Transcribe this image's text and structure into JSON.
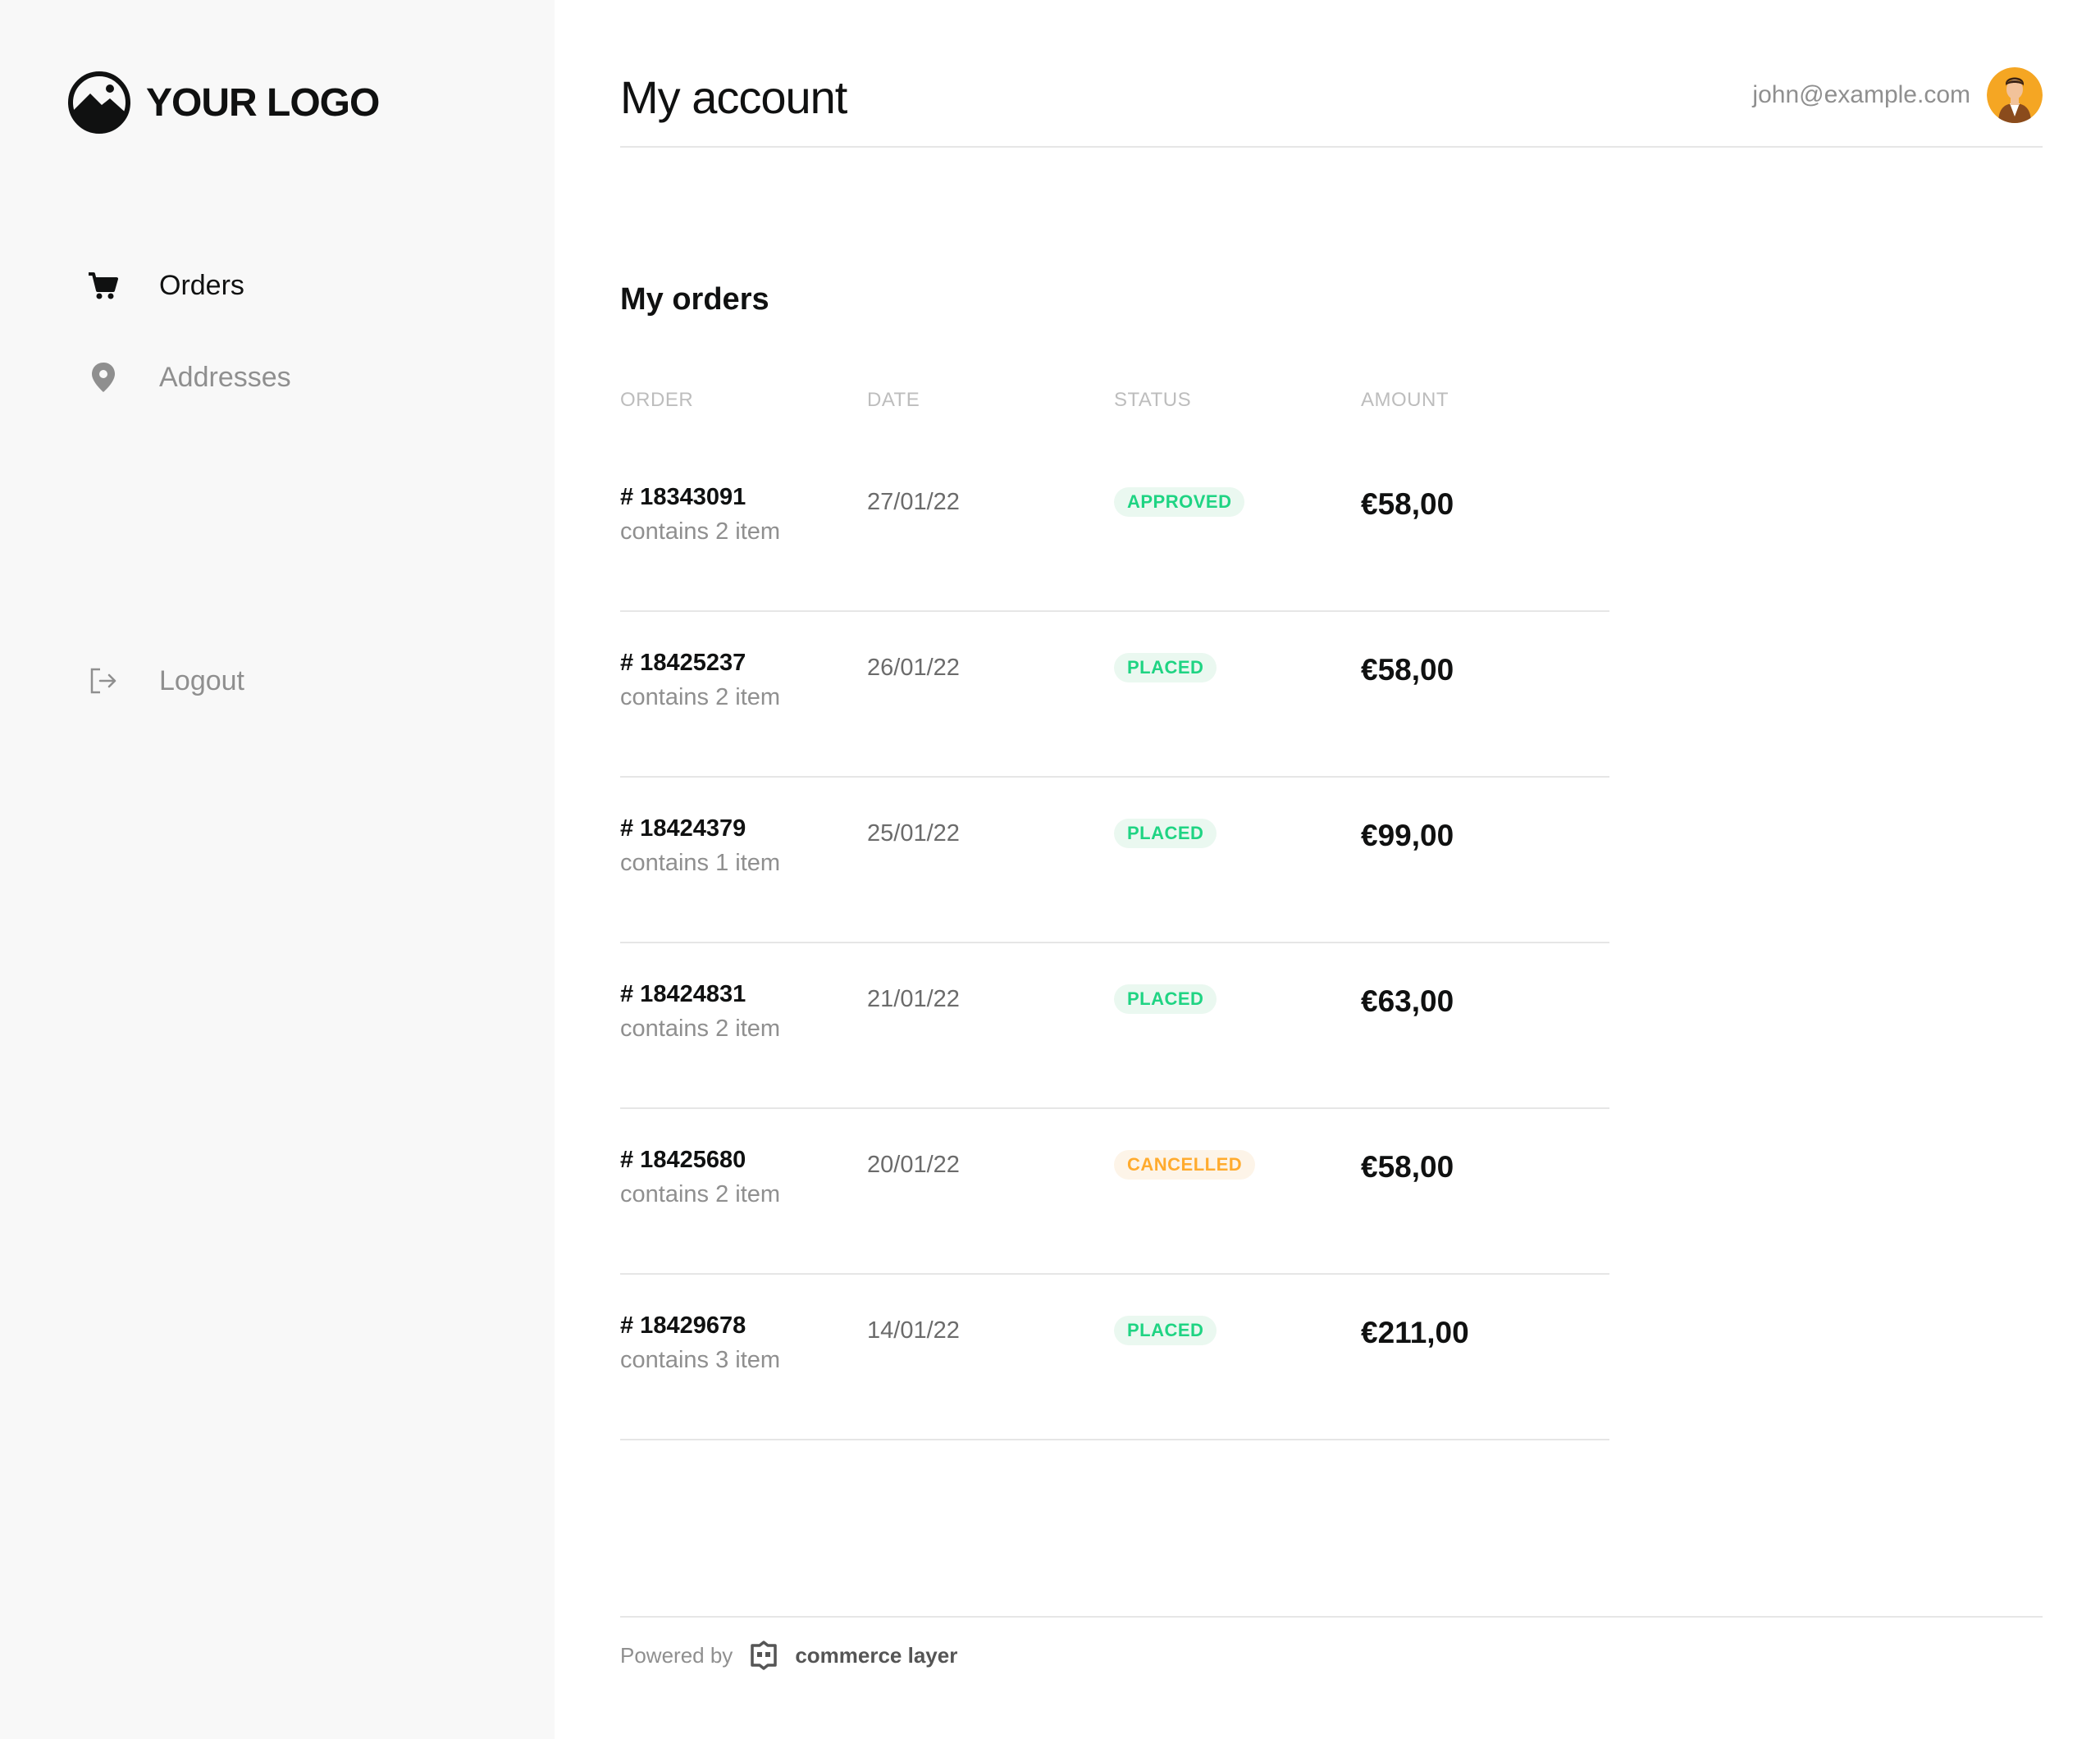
{
  "brand": {
    "logo_text": "YOUR LOGO"
  },
  "sidebar": {
    "items": [
      {
        "label": "Orders",
        "icon": "cart-icon",
        "active": true
      },
      {
        "label": "Addresses",
        "icon": "map-pin-icon",
        "active": false
      }
    ],
    "logout": {
      "label": "Logout",
      "icon": "logout-icon"
    }
  },
  "header": {
    "title": "My account",
    "user_email": "john@example.com"
  },
  "orders": {
    "title": "My orders",
    "columns": [
      "ORDER",
      "DATE",
      "STATUS",
      "AMOUNT"
    ],
    "rows": [
      {
        "number": "# 18343091",
        "items": "contains 2 item",
        "date": "27/01/22",
        "status": "APPROVED",
        "amount": "€58,00"
      },
      {
        "number": "# 18425237",
        "items": "contains 2 item",
        "date": "26/01/22",
        "status": "PLACED",
        "amount": "€58,00"
      },
      {
        "number": "# 18424379",
        "items": "contains 1 item",
        "date": "25/01/22",
        "status": "PLACED",
        "amount": "€99,00"
      },
      {
        "number": "# 18424831",
        "items": "contains 2 item",
        "date": "21/01/22",
        "status": "PLACED",
        "amount": "€63,00"
      },
      {
        "number": "# 18425680",
        "items": "contains 2 item",
        "date": "20/01/22",
        "status": "CANCELLED",
        "amount": "€58,00"
      },
      {
        "number": "# 18429678",
        "items": "contains 3 item",
        "date": "14/01/22",
        "status": "PLACED",
        "amount": "€211,00"
      }
    ]
  },
  "footer": {
    "powered_by": "Powered by",
    "provider": "commerce layer"
  },
  "colors": {
    "status_green": "#1fd483",
    "status_orange": "#ffab2e",
    "sidebar_bg": "#f8f8f8"
  }
}
